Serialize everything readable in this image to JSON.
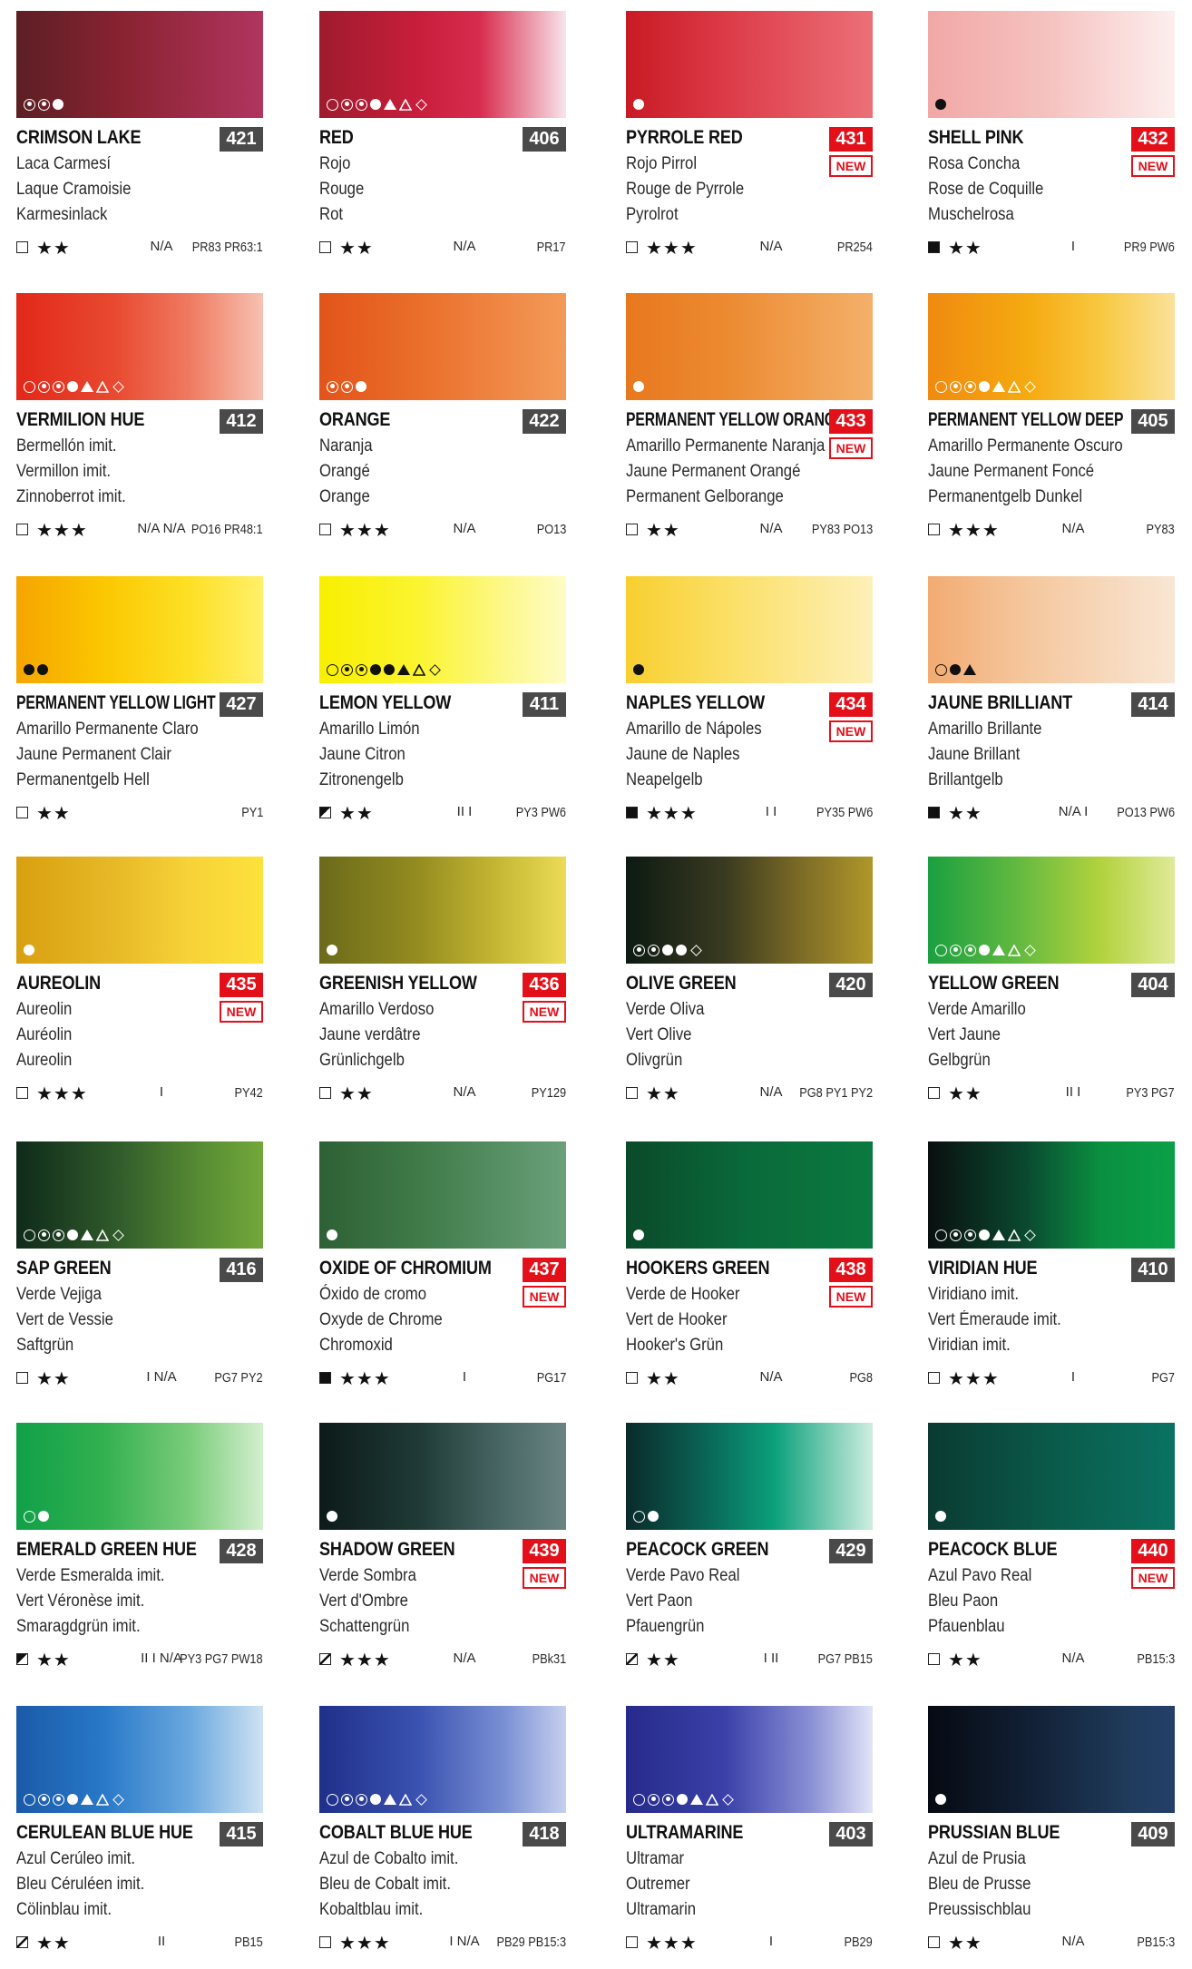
{
  "colors": [
    {
      "name": "CRIMSON LAKE",
      "code": "421",
      "new": false,
      "tr": [
        "Laca Carmesí",
        "Laque Cramoisie",
        "Karmesinlack"
      ],
      "box": "empty",
      "stars": "★★",
      "perm": "N/A",
      "pig": "PR83 PR63:1",
      "grad": "linear-gradient(90deg,#5c1f24,#8b2332 45%,#b03560)",
      "symdark": false,
      "syms": [
        "dot-ring",
        "bull",
        "dot"
      ]
    },
    {
      "name": "RED",
      "code": "406",
      "new": false,
      "tr": [
        "Rojo",
        "Rouge",
        "Rot"
      ],
      "box": "empty",
      "stars": "★★",
      "perm": "N/A",
      "pig": "PR17",
      "grad": "linear-gradient(90deg,#9e1b2d,#c81e3b 40%,#d82c4e 65%,#f8e4ea)",
      "symdark": false,
      "syms": [
        "ring",
        "bull",
        "bull",
        "dot",
        "tri",
        "tri-o",
        "dia"
      ]
    },
    {
      "name": "PYRROLE RED",
      "code": "431",
      "new": true,
      "tr": [
        "Rojo Pirrol",
        "Rouge de Pyrrole",
        "Pyrolrot"
      ],
      "box": "empty",
      "stars": "★★★",
      "perm": "N/A",
      "pig": "PR254",
      "grad": "linear-gradient(90deg,#c81a24,#dc3a47 40%,#ec7078)",
      "symdark": false,
      "syms": [
        "dot"
      ]
    },
    {
      "name": "SHELL PINK",
      "code": "432",
      "new": true,
      "tr": [
        "Rosa Concha",
        "Rose de Coquille",
        "Muschelrosa"
      ],
      "box": "full",
      "stars": "★★",
      "perm": "I",
      "pig": "PR9 PW6",
      "grad": "linear-gradient(90deg,#f1a8a6,#f5c3c0 50%,#fdeeee)",
      "symdark": true,
      "syms": [
        "dot"
      ]
    },
    {
      "name": "VERMILION HUE",
      "code": "412",
      "new": false,
      "tr": [
        "Bermellón imit.",
        "Vermillon imit.",
        "Zinnoberrot imit."
      ],
      "box": "empty",
      "stars": "★★★",
      "perm": "N/A N/A",
      "pig": "PO16 PR48:1",
      "grad": "linear-gradient(90deg,#e2281a,#e84a30 40%,#ef7a60 70%,#f7c1b2)",
      "symdark": false,
      "syms": [
        "ring",
        "bull",
        "bull",
        "dot",
        "tri",
        "tri-o",
        "dia"
      ]
    },
    {
      "name": "ORANGE",
      "code": "422",
      "new": false,
      "tr": [
        "Naranja",
        "Orangé",
        "Orange"
      ],
      "box": "empty",
      "stars": "★★★",
      "perm": "N/A",
      "pig": "PO13",
      "grad": "linear-gradient(90deg,#e2541a,#ea6e2a 40%,#f39a58)",
      "symdark": false,
      "syms": [
        "bull",
        "bull",
        "dot"
      ]
    },
    {
      "name": "PERMANENT YELLOW ORANGE",
      "code": "433",
      "new": true,
      "tr": [
        "Amarillo Permanente Naranja",
        "Jaune Permanent  Orangé",
        "Permanent Gelborange"
      ],
      "box": "empty",
      "stars": "★★",
      "perm": "N/A",
      "pig": "PY83 PO13",
      "grad": "linear-gradient(90deg,#e8781e,#ec8a30 40%,#f4b06a)",
      "symdark": false,
      "syms": [
        "dot"
      ],
      "tight": true
    },
    {
      "name": "PERMANENT YELLOW DEEP",
      "code": "405",
      "new": false,
      "tr": [
        "Amarillo Permanente Oscuro",
        "Jaune Permanent Foncé",
        "Permanentgelb Dunkel"
      ],
      "box": "empty",
      "stars": "★★★",
      "perm": "N/A",
      "pig": "PY83",
      "grad": "linear-gradient(90deg,#f08a10,#f5aa10 40%,#f8c840 70%,#fbe29a)",
      "symdark": false,
      "syms": [
        "ring",
        "bull",
        "bull",
        "dot",
        "tri",
        "tri-o",
        "dia"
      ],
      "tight": true
    },
    {
      "name": "PERMANENT YELLOW LIGHT",
      "code": "427",
      "new": false,
      "tr": [
        "Amarillo Permanente Claro",
        "Jaune Permanent Clair",
        "Permanentgelb Hell"
      ],
      "box": "empty",
      "stars": "★★",
      "perm": "",
      "pig": "PY1",
      "grad": "linear-gradient(90deg,#f5a500,#fbc700 35%,#fde025 70%,#fff06a)",
      "symdark": true,
      "syms": [
        "dot",
        "dot"
      ],
      "tight": true
    },
    {
      "name": "LEMON YELLOW",
      "code": "411",
      "new": false,
      "tr": [
        "Amarillo Limón",
        "Jaune Citron",
        "Zitronengelb"
      ],
      "box": "half",
      "stars": "★★",
      "perm": "II I",
      "pig": "PY3 PW6",
      "grad": "linear-gradient(90deg,#f8ef00,#fbf430 40%,#fdf88a 75%,#fefcc6)",
      "symdark": true,
      "syms": [
        "ring",
        "bull",
        "bull",
        "dot",
        "dot",
        "tri",
        "tri-o",
        "dia"
      ]
    },
    {
      "name": "NAPLES YELLOW",
      "code": "434",
      "new": true,
      "tr": [
        "Amarillo de Nápoles",
        "Jaune de Naples",
        "Neapelgelb"
      ],
      "box": "full",
      "stars": "★★★",
      "perm": "I I",
      "pig": "PY35 PW6",
      "grad": "linear-gradient(90deg,#f8cf30,#fbdf64 40%,#fdf0b8)",
      "symdark": true,
      "syms": [
        "dot"
      ]
    },
    {
      "name": "JAUNE BRILLIANT",
      "code": "414",
      "new": false,
      "tr": [
        "Amarillo Brillante",
        "Jaune Brillant",
        "Brillantgelb"
      ],
      "box": "full",
      "stars": "★★",
      "perm": "N/A I",
      "pig": "PO13 PW6",
      "grad": "linear-gradient(90deg,#f2ab72,#f5c79d 40%,#f8e6d4)",
      "symdark": true,
      "syms": [
        "ring",
        "dot",
        "tri"
      ]
    },
    {
      "name": "AUREOLIN",
      "code": "435",
      "new": true,
      "tr": [
        "Aureolin",
        "Auréolin",
        "Aureolin"
      ],
      "box": "empty",
      "stars": "★★★",
      "perm": "I",
      "pig": "PY42",
      "grad": "linear-gradient(90deg,#d8a010,#e7b928 40%,#f7d238 70%,#fce23c)",
      "symdark": false,
      "syms": [
        "dot"
      ]
    },
    {
      "name": "GREENISH YELLOW",
      "code": "436",
      "new": true,
      "tr": [
        "Amarillo Verdoso",
        "Jaune verdâtre",
        "Grünlichgelb"
      ],
      "box": "empty",
      "stars": "★★",
      "perm": "N/A",
      "pig": "PY129",
      "grad": "linear-gradient(90deg,#6b6a1a,#948c20 40%,#c2b432 70%,#ebdb55)",
      "symdark": false,
      "syms": [
        "dot"
      ]
    },
    {
      "name": "OLIVE GREEN",
      "code": "420",
      "new": false,
      "tr": [
        "Verde Oliva",
        "Vert Olive",
        "Olivgrün"
      ],
      "box": "empty",
      "stars": "★★",
      "perm": "N/A",
      "pig": "PG8 PY1 PY2",
      "grad": "linear-gradient(90deg,#0c1a12,#3a3a20 40%,#7a6a26 70%,#b0972a)",
      "symdark": false,
      "syms": [
        "bull",
        "bull",
        "dot",
        "dot",
        "dia"
      ]
    },
    {
      "name": "YELLOW GREEN",
      "code": "404",
      "new": false,
      "tr": [
        "Verde Amarillo",
        "Vert Jaune",
        "Gelbgrün"
      ],
      "box": "empty",
      "stars": "★★",
      "perm": "II I",
      "pig": "PY3 PG7",
      "grad": "linear-gradient(90deg,#1aa040,#60b840 35%,#b2d23e 70%,#e0ea98)",
      "symdark": false,
      "syms": [
        "ring",
        "bull",
        "bull",
        "dot",
        "tri",
        "tri-o",
        "dia"
      ]
    },
    {
      "name": "SAP GREEN",
      "code": "416",
      "new": false,
      "tr": [
        "Verde Vejiga",
        "Vert de Vessie",
        "Saftgrün"
      ],
      "box": "empty",
      "stars": "★★",
      "perm": "I N/A",
      "pig": "PG7 PY2",
      "grad": "linear-gradient(90deg,#0f2a1a,#2f5a2a 40%,#588c34 75%,#72a83a)",
      "symdark": false,
      "syms": [
        "ring",
        "bull",
        "bull",
        "dot",
        "tri",
        "tri-o",
        "dia"
      ]
    },
    {
      "name": "OXIDE OF CHROMIUM",
      "code": "437",
      "new": true,
      "tr": [
        "Óxido de cromo",
        "Oxyde de Chrome",
        "Chromoxid"
      ],
      "box": "full",
      "stars": "★★★",
      "perm": "I",
      "pig": "PG17",
      "grad": "linear-gradient(90deg,#2e6035,#3f7a48 40%,#6aa07a)",
      "symdark": false,
      "syms": [
        "dot"
      ]
    },
    {
      "name": "HOOKERS GREEN",
      "code": "438",
      "new": true,
      "tr": [
        "Verde de Hooker",
        "Vert de Hooker",
        "Hooker's Grün"
      ],
      "box": "empty",
      "stars": "★★",
      "perm": "N/A",
      "pig": "PG8",
      "grad": "linear-gradient(90deg,#0a4a2a,#0a6a3a 50%,#0a7a40)",
      "symdark": false,
      "syms": [
        "dot"
      ]
    },
    {
      "name": "VIRIDIAN HUE",
      "code": "410",
      "new": false,
      "tr": [
        "Viridiano imit.",
        "Vert Émeraude imit.",
        "Viridian imit."
      ],
      "box": "empty",
      "stars": "★★★",
      "perm": "I",
      "pig": "PG7",
      "grad": "linear-gradient(90deg,#0a0f0f,#0a4a30 40%,#0a9040 70%,#0aa048)",
      "symdark": false,
      "syms": [
        "ring",
        "bull",
        "bull",
        "dot",
        "tri",
        "tri-o",
        "dia"
      ]
    },
    {
      "name": "EMERALD GREEN HUE",
      "code": "428",
      "new": false,
      "tr": [
        "Verde Esmeralda imit.",
        "Vert Véronèse imit.",
        "Smaragdgrün imit."
      ],
      "box": "half",
      "stars": "★★",
      "perm": "II I N/A",
      "pig": "PY3 PG7 PW18",
      "grad": "linear-gradient(90deg,#10a048,#32b050 35%,#7acc7a 70%,#d4efcf)",
      "symdark": false,
      "syms": [
        "ring",
        "dot"
      ]
    },
    {
      "name": "SHADOW GREEN",
      "code": "439",
      "new": true,
      "tr": [
        "Verde Sombra",
        "Vert d'Ombre",
        "Schattengrün"
      ],
      "box": "hatch",
      "stars": "★★★",
      "perm": "N/A",
      "pig": "PBk31",
      "grad": "linear-gradient(90deg,#0c1a18,#1f3a36 40%,#4a6866 75%,#6a8482)",
      "symdark": false,
      "syms": [
        "dot"
      ]
    },
    {
      "name": "PEACOCK GREEN",
      "code": "429",
      "new": false,
      "tr": [
        "Verde Pavo Real",
        "Vert Paon",
        "Pfauengrün"
      ],
      "box": "hatch",
      "stars": "★★",
      "perm": "I II",
      "pig": "PG7 PB15",
      "grad": "linear-gradient(90deg,#0a2a2a,#0a6a5a 35%,#0aa07a 60%,#cfeee0)",
      "symdark": false,
      "syms": [
        "ring",
        "dot"
      ]
    },
    {
      "name": "PEACOCK BLUE",
      "code": "440",
      "new": true,
      "tr": [
        "Azul Pavo Real",
        "Bleu Paon",
        "Pfauenblau"
      ],
      "box": "empty",
      "stars": "★★",
      "perm": "N/A",
      "pig": "PB15:3",
      "grad": "linear-gradient(90deg,#0a3a32,#0a5a4a 50%,#0a7262)",
      "symdark": false,
      "syms": [
        "dot"
      ]
    },
    {
      "name": "CERULEAN BLUE HUE",
      "code": "415",
      "new": false,
      "tr": [
        "Azul Cerúleo imit.",
        "Bleu Céruléen imit.",
        "Cölinblau imit."
      ],
      "box": "hatch",
      "stars": "★★",
      "perm": "II",
      "pig": "PB15",
      "grad": "linear-gradient(90deg,#1a5aa8,#2878c8 35%,#6aa8de 70%,#cfe2f2)",
      "symdark": false,
      "syms": [
        "ring",
        "bull",
        "bull",
        "dot",
        "tri",
        "tri-o",
        "dia"
      ]
    },
    {
      "name": "COBALT BLUE HUE",
      "code": "418",
      "new": false,
      "tr": [
        "Azul de Cobalto imit.",
        "Bleu de Cobalt imit.",
        "Kobaltblau imit."
      ],
      "box": "empty",
      "stars": "★★★",
      "perm": "I N/A",
      "pig": "PB29 PB15:3",
      "grad": "linear-gradient(90deg,#1f2f8a,#3a52b0 40%,#7a90d4 75%,#c6d0ee)",
      "symdark": false,
      "syms": [
        "ring",
        "bull",
        "bull",
        "dot",
        "tri",
        "tri-o",
        "dia"
      ]
    },
    {
      "name": "ULTRAMARINE",
      "code": "403",
      "new": false,
      "tr": [
        "Ultramar",
        "Outremer",
        "Ultramarin"
      ],
      "box": "empty",
      "stars": "★★★",
      "perm": "I",
      "pig": "PB29",
      "grad": "linear-gradient(90deg,#262a8a,#3a40a8 40%,#8a90d4 75%,#e2e4f6)",
      "symdark": false,
      "syms": [
        "ring",
        "bull",
        "bull",
        "dot",
        "tri",
        "tri-o",
        "dia"
      ]
    },
    {
      "name": "PRUSSIAN BLUE",
      "code": "409",
      "new": false,
      "tr": [
        "Azul de Prusia",
        "Bleu de Prusse",
        "Preussischblau"
      ],
      "box": "empty",
      "stars": "★★",
      "perm": "N/A",
      "pig": "PB15:3",
      "grad": "linear-gradient(90deg,#060a12,#132238 45%,#1f3a5a 80%,#24406a)",
      "symdark": false,
      "syms": [
        "dot"
      ]
    }
  ]
}
